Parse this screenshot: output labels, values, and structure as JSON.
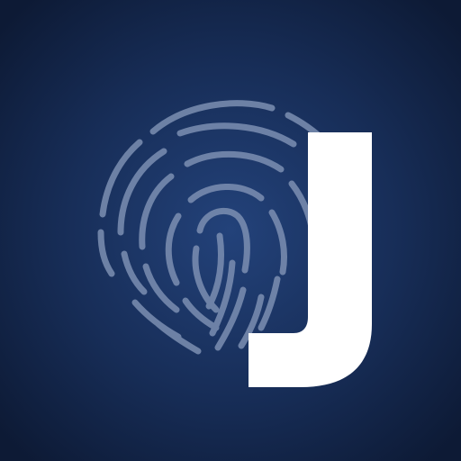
{
  "icon": {
    "name": "fingerprint-j-logo",
    "glyph_name": "fingerprint-icon",
    "letter": "J"
  },
  "colors": {
    "background_center": "#23427a",
    "background_mid": "#172d57",
    "background_edge": "#0d1a35",
    "fingerprint_stroke": "#7c8fb2",
    "letter_fill": "#ffffff"
  }
}
